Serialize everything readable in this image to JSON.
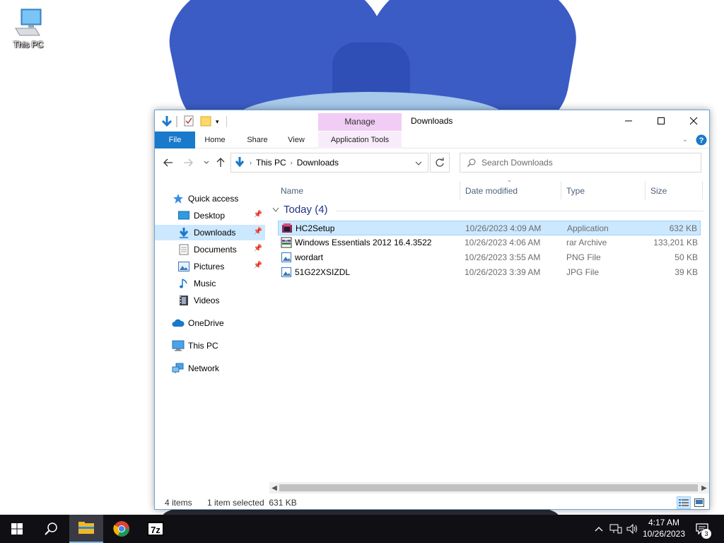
{
  "desktop": {
    "icon_label": "This PC"
  },
  "window": {
    "title": "Downloads",
    "contextual_tab": "Manage",
    "ribbon_tabs": [
      "File",
      "Home",
      "Share",
      "View",
      "Application Tools"
    ],
    "address": {
      "segments": [
        "This PC",
        "Downloads"
      ]
    },
    "search_placeholder": "Search Downloads"
  },
  "navpane": {
    "items": [
      {
        "label": "Quick access",
        "icon": "star-icon",
        "pinned": false
      },
      {
        "label": "Desktop",
        "icon": "desktop-folder-icon",
        "pinned": true
      },
      {
        "label": "Downloads",
        "icon": "downloads-folder-icon",
        "pinned": true,
        "selected": true
      },
      {
        "label": "Documents",
        "icon": "documents-folder-icon",
        "pinned": true
      },
      {
        "label": "Pictures",
        "icon": "pictures-folder-icon",
        "pinned": true
      },
      {
        "label": "Music",
        "icon": "music-folder-icon",
        "pinned": false
      },
      {
        "label": "Videos",
        "icon": "videos-folder-icon",
        "pinned": false
      },
      {
        "label": "OneDrive",
        "icon": "onedrive-icon",
        "pinned": false
      },
      {
        "label": "This PC",
        "icon": "this-pc-icon",
        "pinned": false
      },
      {
        "label": "Network",
        "icon": "network-icon",
        "pinned": false
      }
    ]
  },
  "filelist": {
    "columns": [
      "Name",
      "Date modified",
      "Type",
      "Size"
    ],
    "group_label": "Today (4)",
    "rows": [
      {
        "name": "HC2Setup",
        "date": "10/26/2023 4:09 AM",
        "type": "Application",
        "size": "632 KB",
        "icon": "setup-app-icon",
        "selected": true
      },
      {
        "name": "Windows Essentials 2012 16.4.3522",
        "date": "10/26/2023 4:06 AM",
        "type": "rar Archive",
        "size": "133,201 KB",
        "icon": "rar-archive-icon",
        "selected": false
      },
      {
        "name": "wordart",
        "date": "10/26/2023 3:55 AM",
        "type": "PNG File",
        "size": "50 KB",
        "icon": "image-file-icon",
        "selected": false
      },
      {
        "name": "51G22XSIZDL",
        "date": "10/26/2023 3:39 AM",
        "type": "JPG File",
        "size": "39 KB",
        "icon": "image-file-icon",
        "selected": false
      }
    ]
  },
  "status": {
    "item_count": "4 items",
    "selection": "1 item selected  631 KB"
  },
  "taskbar": {
    "time": "4:17 AM",
    "date": "10/26/2023",
    "notification_count": "3",
    "seven_zip_label": "7z"
  },
  "colors": {
    "accent": "#1979ca",
    "selection": "#cce8ff",
    "manage_tab": "#f1ccf5",
    "taskbar": "#101014"
  }
}
